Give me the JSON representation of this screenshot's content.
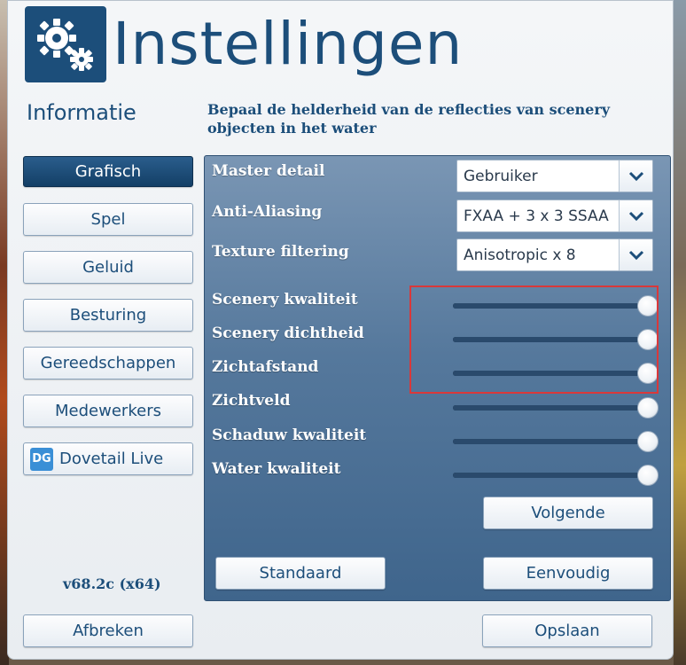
{
  "header": {
    "title": "Instellingen",
    "logo_icon": "gears-icon",
    "accent_color": "#1c4e7a"
  },
  "info": {
    "title": "Informatie",
    "description": "Bepaal de helderheid van de reflecties van scenery objecten in het water"
  },
  "nav": {
    "items": [
      {
        "label": "Grafisch",
        "active": true
      },
      {
        "label": "Spel"
      },
      {
        "label": "Geluid"
      },
      {
        "label": "Besturing"
      },
      {
        "label": "Gereedschappen"
      },
      {
        "label": "Medewerkers"
      },
      {
        "label": "Dovetail Live",
        "icon": "dovetail-live-icon",
        "icon_text": "DG"
      }
    ],
    "version": "v68.2c (x64)",
    "cancel_label": "Afbreken"
  },
  "settings": {
    "dropdowns": [
      {
        "label": "Master detail",
        "value": "Gebruiker"
      },
      {
        "label": "Anti-Aliasing",
        "value": "FXAA + 3 x 3 SSAA"
      },
      {
        "label": "Texture filtering",
        "value": "Anisotropic x 8"
      }
    ],
    "sliders": [
      {
        "label": "Scenery kwaliteit",
        "value": 1.0
      },
      {
        "label": "Scenery dichtheid",
        "value": 1.0
      },
      {
        "label": "Zichtafstand",
        "value": 1.0
      },
      {
        "label": "Zichtveld",
        "value": 1.0
      },
      {
        "label": "Schaduw kwaliteit",
        "value": 1.0
      },
      {
        "label": "Water kwaliteit",
        "value": 1.0
      }
    ],
    "next_label": "Volgende",
    "default_label": "Standaard",
    "simple_label": "Eenvoudig"
  },
  "footer": {
    "save_label": "Opslaan"
  },
  "highlight_color": "#d9383a"
}
